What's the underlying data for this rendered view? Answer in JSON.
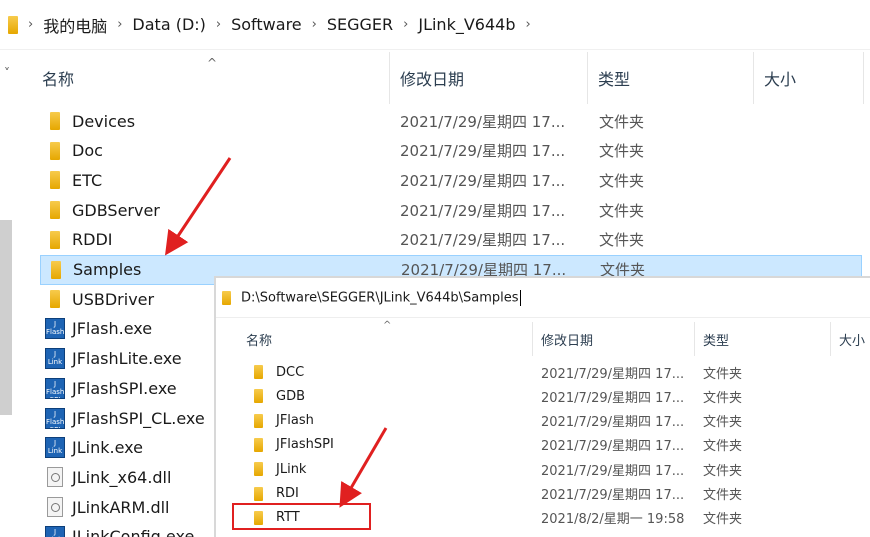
{
  "window1": {
    "breadcrumb": [
      "我的电脑",
      "Data (D:)",
      "Software",
      "SEGGER",
      "JLink_V644b"
    ],
    "columns": {
      "name": "名称",
      "date": "修改日期",
      "type": "类型",
      "size": "大小"
    },
    "rows": [
      {
        "name": "Devices",
        "icon": "folder-icon",
        "date": "2021/7/29/星期四 17...",
        "type": "文件夹"
      },
      {
        "name": "Doc",
        "icon": "folder-icon",
        "date": "2021/7/29/星期四 17...",
        "type": "文件夹"
      },
      {
        "name": "ETC",
        "icon": "folder-icon",
        "date": "2021/7/29/星期四 17...",
        "type": "文件夹"
      },
      {
        "name": "GDBServer",
        "icon": "folder-icon",
        "date": "2021/7/29/星期四 17...",
        "type": "文件夹"
      },
      {
        "name": "RDDI",
        "icon": "folder-icon",
        "date": "2021/7/29/星期四 17...",
        "type": "文件夹"
      },
      {
        "name": "Samples",
        "icon": "folder-icon",
        "date": "2021/7/29/星期四 17...",
        "type": "文件夹",
        "selected": true
      },
      {
        "name": "USBDriver",
        "icon": "folder-icon"
      },
      {
        "name": "JFlash.exe",
        "icon": "jflash-exe-icon",
        "iconText": "J Flash"
      },
      {
        "name": "JFlashLite.exe",
        "icon": "jlink-exe-icon",
        "iconText": "J Link"
      },
      {
        "name": "JFlashSPI.exe",
        "icon": "jflash-spi-exe-icon",
        "iconText": "J Flash SPI"
      },
      {
        "name": "JFlashSPI_CL.exe",
        "icon": "jflash-spi-exe-icon",
        "iconText": "J Flash SPI"
      },
      {
        "name": "JLink.exe",
        "icon": "jlink-exe-icon",
        "iconText": "J Link"
      },
      {
        "name": "JLink_x64.dll",
        "icon": "dll-file-icon"
      },
      {
        "name": "JLinkARM.dll",
        "icon": "dll-file-icon"
      },
      {
        "name": "JLinkConfig.exe",
        "icon": "jlink-exe-icon",
        "iconText": "J Link"
      }
    ]
  },
  "window2": {
    "address": "D:\\Software\\SEGGER\\JLink_V644b\\Samples",
    "columns": {
      "name": "名称",
      "date": "修改日期",
      "type": "类型",
      "size": "大小"
    },
    "rows": [
      {
        "name": "DCC",
        "date": "2021/7/29/星期四 17...",
        "type": "文件夹"
      },
      {
        "name": "GDB",
        "date": "2021/7/29/星期四 17...",
        "type": "文件夹"
      },
      {
        "name": "JFlash",
        "date": "2021/7/29/星期四 17...",
        "type": "文件夹"
      },
      {
        "name": "JFlashSPI",
        "date": "2021/7/29/星期四 17...",
        "type": "文件夹"
      },
      {
        "name": "JLink",
        "date": "2021/7/29/星期四 17...",
        "type": "文件夹"
      },
      {
        "name": "RDI",
        "date": "2021/7/29/星期四 17...",
        "type": "文件夹"
      },
      {
        "name": "RTT",
        "date": "2021/8/2/星期一 19:58",
        "type": "文件夹",
        "highlighted": true
      }
    ]
  },
  "colors": {
    "selection": "#cce8ff",
    "selection_border": "#99d1ff",
    "annotation": "#e02020",
    "folder": "#f2b51f"
  }
}
